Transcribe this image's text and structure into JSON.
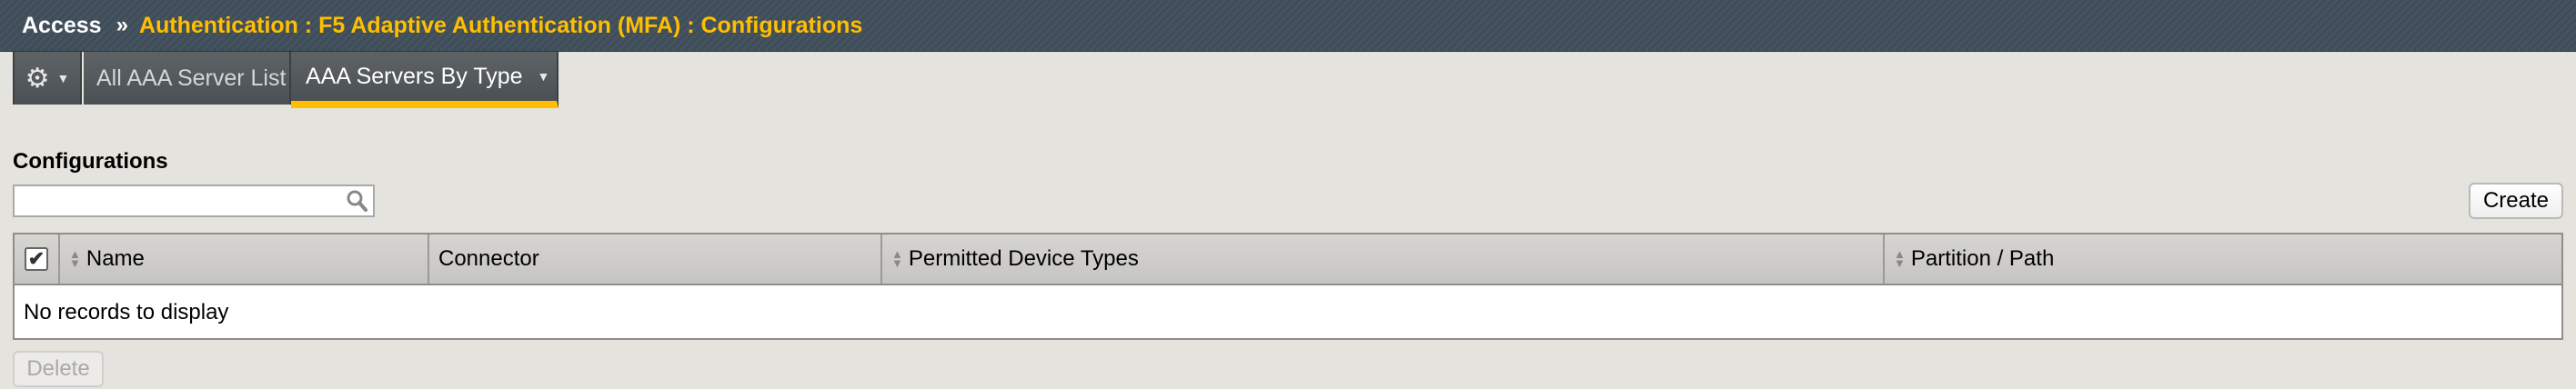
{
  "breadcrumb": {
    "root": "Access",
    "separator": "»",
    "path": "Authentication : F5 Adaptive Authentication (MFA) : Configurations"
  },
  "tabs": {
    "gear_icon": "gear-icon",
    "items": [
      {
        "label": "All AAA Server List",
        "active": false
      },
      {
        "label": "AAA Servers By Type",
        "active": true
      }
    ]
  },
  "section": {
    "title": "Configurations"
  },
  "search": {
    "value": "",
    "placeholder": ""
  },
  "buttons": {
    "create": "Create",
    "delete": "Delete"
  },
  "table": {
    "columns": [
      "Name",
      "Connector",
      "Permitted Device Types",
      "Partition / Path"
    ],
    "select_all_checked": true,
    "empty_message": "No records to display"
  },
  "colors": {
    "accent": "#ffbf00",
    "topbar": "#3f4d5a"
  }
}
